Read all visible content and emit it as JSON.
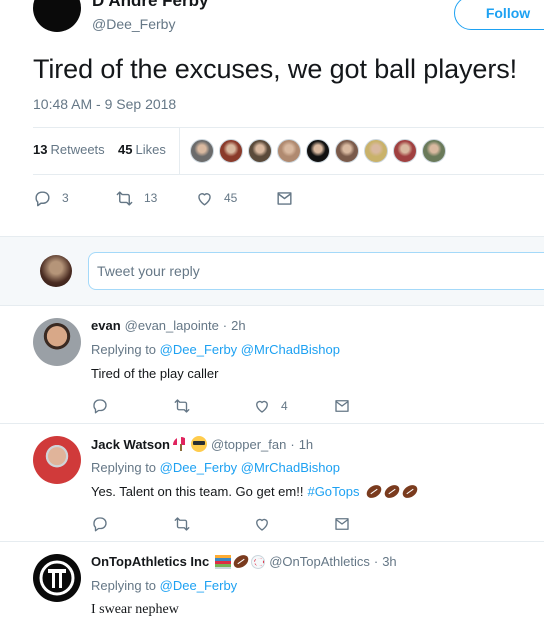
{
  "tweet": {
    "author_name": "D'Andre Ferby",
    "author_handle": "@Dee_Ferby",
    "follow_label": "Follow",
    "text": "Tired of the excuses, we got ball players!",
    "timestamp": "10:48 AM - 9 Sep 2018",
    "retweets_count": "13",
    "retweets_label": "Retweets",
    "likes_count": "45",
    "likes_label": "Likes",
    "liker_avatar_colors": [
      "#6b6b6b",
      "#8a3a2a",
      "#5a4a3a",
      "#b08a70",
      "#111111",
      "#7a5a4a",
      "#c9b26a",
      "#a04040",
      "#6a7a5a"
    ],
    "actions": {
      "reply_count": "3",
      "retweet_count": "13",
      "like_count": "45"
    }
  },
  "reply_box": {
    "placeholder": "Tweet your reply"
  },
  "replies": [
    {
      "name": "evan",
      "handle": "@evan_lapointe",
      "time": "2h",
      "replying_prefix": "Replying to",
      "mentions": "@Dee_Ferby @MrChadBishop",
      "text": "Tired of the play caller",
      "like_count": "4"
    },
    {
      "name": "Jack Watson",
      "handle": "@topper_fan",
      "time": "1h",
      "replying_prefix": "Replying to",
      "mentions": "@Dee_Ferby @MrChadBishop",
      "text": "Yes. Talent on this team. Go get em!!",
      "hashtag": "#GoTops",
      "like_count": ""
    },
    {
      "name": "OnTopAthletics Inc",
      "handle": "@OnTopAthletics",
      "time": "3h",
      "replying_prefix": "Replying to",
      "mentions": "@Dee_Ferby",
      "text": "I swear nephew"
    }
  ],
  "separator": "·",
  "colors": {
    "accent": "#1da1f2",
    "muted": "#657786",
    "text": "#14171a",
    "border": "#e6ecf0"
  }
}
